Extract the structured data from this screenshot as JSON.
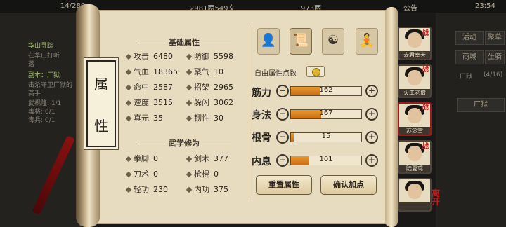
{
  "topbar": {
    "level_fragment": "14/280",
    "money": "2981两549文",
    "silver": "973两",
    "announce": "公告",
    "time": "23:54"
  },
  "background_left": {
    "quest_title": "华山寻踪",
    "quest_line1": "在华山打听",
    "quest_line2": "落",
    "dungeon": "副本：厂狱",
    "desc1": "击杀守卫厂狱的",
    "desc2": "高手",
    "counts": [
      "1/1",
      "0/1",
      "0/1"
    ],
    "labels": [
      "武视隆",
      "毒将",
      "毒兵"
    ]
  },
  "background_right": {
    "buttons": [
      "活动",
      "聚草",
      "商城",
      "坐骑"
    ],
    "area": "厂狱",
    "level_range": "(4/16)",
    "area_item": "厂狱"
  },
  "panel": {
    "vertical_title": [
      "属",
      "性"
    ],
    "basic_header": "基础属性",
    "basic_stats": [
      {
        "label": "攻击",
        "value": "6480"
      },
      {
        "label": "防御",
        "value": "5598"
      },
      {
        "label": "气血",
        "value": "18365"
      },
      {
        "label": "聚气",
        "value": "10"
      },
      {
        "label": "命中",
        "value": "2587"
      },
      {
        "label": "招架",
        "value": "2965"
      },
      {
        "label": "速度",
        "value": "3515"
      },
      {
        "label": "躲闪",
        "value": "3062"
      },
      {
        "label": "真元",
        "value": "35"
      },
      {
        "label": "韧性",
        "value": "30"
      }
    ],
    "martial_header": "武学修为",
    "martial_stats": [
      {
        "label": "拳脚",
        "value": "0"
      },
      {
        "label": "剑术",
        "value": "377"
      },
      {
        "label": "刀术",
        "value": "0"
      },
      {
        "label": "枪棍",
        "value": "0"
      },
      {
        "label": "轻功",
        "value": "230"
      },
      {
        "label": "内功",
        "value": "375"
      }
    ],
    "free_points_label": "自由属性点数",
    "free_points_value": "",
    "attributes": [
      {
        "name": "筋力",
        "value": "162",
        "fill": 0.42
      },
      {
        "name": "身法",
        "value": "167",
        "fill": 0.43
      },
      {
        "name": "根骨",
        "value": "15",
        "fill": 0.04
      },
      {
        "name": "内息",
        "value": "101",
        "fill": 0.26
      }
    ],
    "reset_label": "重置属性",
    "confirm_label": "确认加点"
  },
  "heroes": [
    {
      "name": "去君奉天"
    },
    {
      "name": "火工老僧"
    },
    {
      "name": "苏念雪"
    },
    {
      "name": "陆夏鸢"
    },
    {
      "name": ""
    }
  ],
  "hero_badge": "战",
  "leave_label": "离开"
}
